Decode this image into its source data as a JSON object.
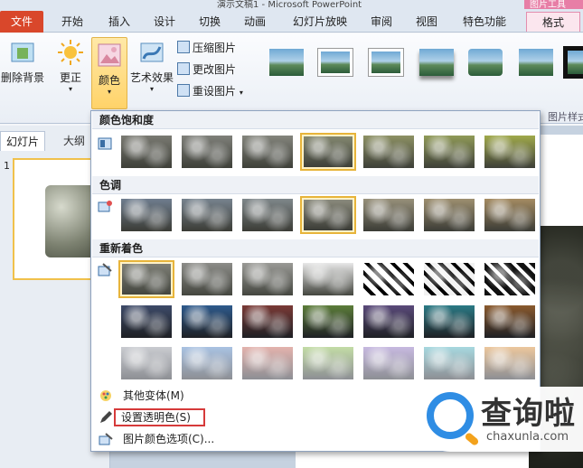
{
  "titlebar": {
    "title": "演示文稿1 - Microsoft PowerPoint",
    "context_tools": "图片工具"
  },
  "tabs": [
    {
      "label": "文件"
    },
    {
      "label": "开始"
    },
    {
      "label": "插入"
    },
    {
      "label": "设计"
    },
    {
      "label": "切换"
    },
    {
      "label": "动画"
    },
    {
      "label": "幻灯片放映"
    },
    {
      "label": "审阅"
    },
    {
      "label": "视图"
    },
    {
      "label": "特色功能"
    },
    {
      "label": "格式"
    }
  ],
  "ribbon": {
    "remove_bg": "删除背景",
    "corrections": "更正",
    "color": "颜色",
    "artistic": "艺术效果",
    "compress": "压缩图片",
    "change": "更改图片",
    "reset": "重设图片",
    "styles_group": "图片样式"
  },
  "slide_pane": {
    "tab_slides": "幻灯片",
    "tab_outline": "大纲",
    "slide_number": "1"
  },
  "dropdown": {
    "sec_saturation": "颜色饱和度",
    "sec_tone": "色调",
    "sec_recolor": "重新着色",
    "more_variants": "其他变体(M)",
    "set_transparent": "设置透明色(S)",
    "picture_color_options": "图片颜色选项(C)...",
    "selected_recolor": "No Recolor"
  },
  "watermark": {
    "name": "查询啦",
    "domain": "chaxunla.com"
  },
  "colors": {
    "file_tab": "#d9472b",
    "context_tab": "#e77ea6",
    "highlight_border": "#d63a3a",
    "selected_swatch": "#e7b43a",
    "watermark_blue": "#2f8de4"
  }
}
